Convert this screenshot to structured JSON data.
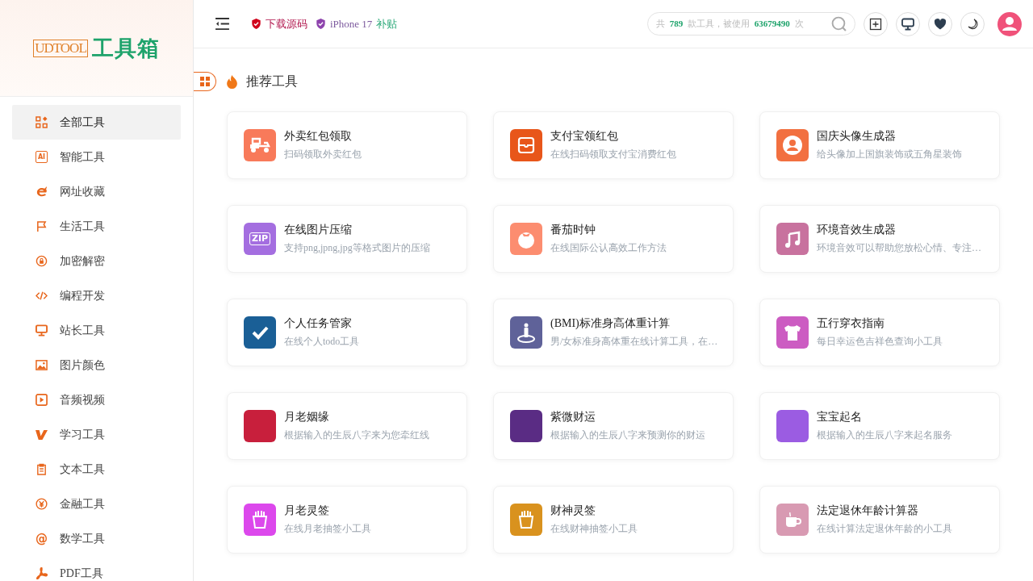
{
  "logo": {
    "brand": "UDTOOL",
    "title": "工具箱"
  },
  "sidebar": {
    "items": [
      {
        "label": "全部工具",
        "selected": true
      },
      {
        "label": "智能工具",
        "glyph": "AI",
        "selected": false
      },
      {
        "label": "网址收藏",
        "selected": false
      },
      {
        "label": "生活工具",
        "selected": false
      },
      {
        "label": "加密解密",
        "selected": false
      },
      {
        "label": "编程开发",
        "selected": false
      },
      {
        "label": "站长工具",
        "selected": false
      },
      {
        "label": "图片颜色",
        "selected": false
      },
      {
        "label": "音频视频",
        "selected": false
      },
      {
        "label": "学习工具",
        "selected": false
      },
      {
        "label": "文本工具",
        "selected": false
      },
      {
        "label": "金融工具",
        "selected": false
      },
      {
        "label": "数学工具",
        "glyph": "@",
        "selected": false
      },
      {
        "label": "PDF工具",
        "selected": false
      }
    ]
  },
  "header": {
    "links": [
      {
        "kind": "source",
        "text": "下载源码",
        "color": "#d0021b"
      },
      {
        "kind": "promo",
        "text": "iPhone 17",
        "extra": "补贴",
        "color": "#8e44ad"
      }
    ],
    "search": {
      "text": "共 **789** 款工具，被使用 **63679490** 次"
    }
  },
  "section": {
    "title": "推荐工具"
  },
  "cards": [
    {
      "title": "外卖红包领取",
      "desc": "扫码领取外卖红包",
      "color": "#f87a5a"
    },
    {
      "title": "支付宝领红包",
      "desc": "在线扫码领取支付宝消费红包",
      "color": "#e8561a"
    },
    {
      "title": "国庆头像生成器",
      "desc": "给头像加上国旗装饰或五角星装饰",
      "color": "#f27040"
    },
    {
      "title": "在线图片压缩",
      "desc": "支持png,jpng,jpg等格式图片的压缩",
      "glyph": "ZIP",
      "color": "#a46ee0"
    },
    {
      "title": "番茄时钟",
      "desc": "在线国际公认高效工作方法",
      "color": "#fc8d70"
    },
    {
      "title": "环境音效生成器",
      "desc": "环境音效可以帮助您放松心情、专注…",
      "color": "#c8729e"
    },
    {
      "title": "个人任务管家",
      "desc": "在线个人todo工具",
      "color": "#1a5f96"
    },
    {
      "title": "(BMI)标准身高体重计算",
      "desc": "男/女标准身高体重在线计算工具，在…",
      "color": "#5f6299"
    },
    {
      "title": "五行穿衣指南",
      "desc": "每日幸运色吉祥色查询小工具",
      "color": "#cc5cc2"
    },
    {
      "title": "月老姻缘",
      "desc": "根据输入的生辰八字来为您牵红线",
      "color": "#c81f3c"
    },
    {
      "title": "紫微财运",
      "desc": "根据输入的生辰八字来预测你的财运",
      "color": "#5a2c84"
    },
    {
      "title": "宝宝起名",
      "desc": "根据输入的生辰八字来起名服务",
      "color": "#9b5ce2"
    },
    {
      "title": "月老灵签",
      "desc": "在线月老抽签小工具",
      "color": "#dc48ec"
    },
    {
      "title": "财神灵签",
      "desc": "在线财神抽签小工具",
      "color": "#d9921e"
    },
    {
      "title": "法定退休年龄计算器",
      "desc": "在线计算法定退休年龄的小工具",
      "color": "#d89ab2"
    }
  ]
}
